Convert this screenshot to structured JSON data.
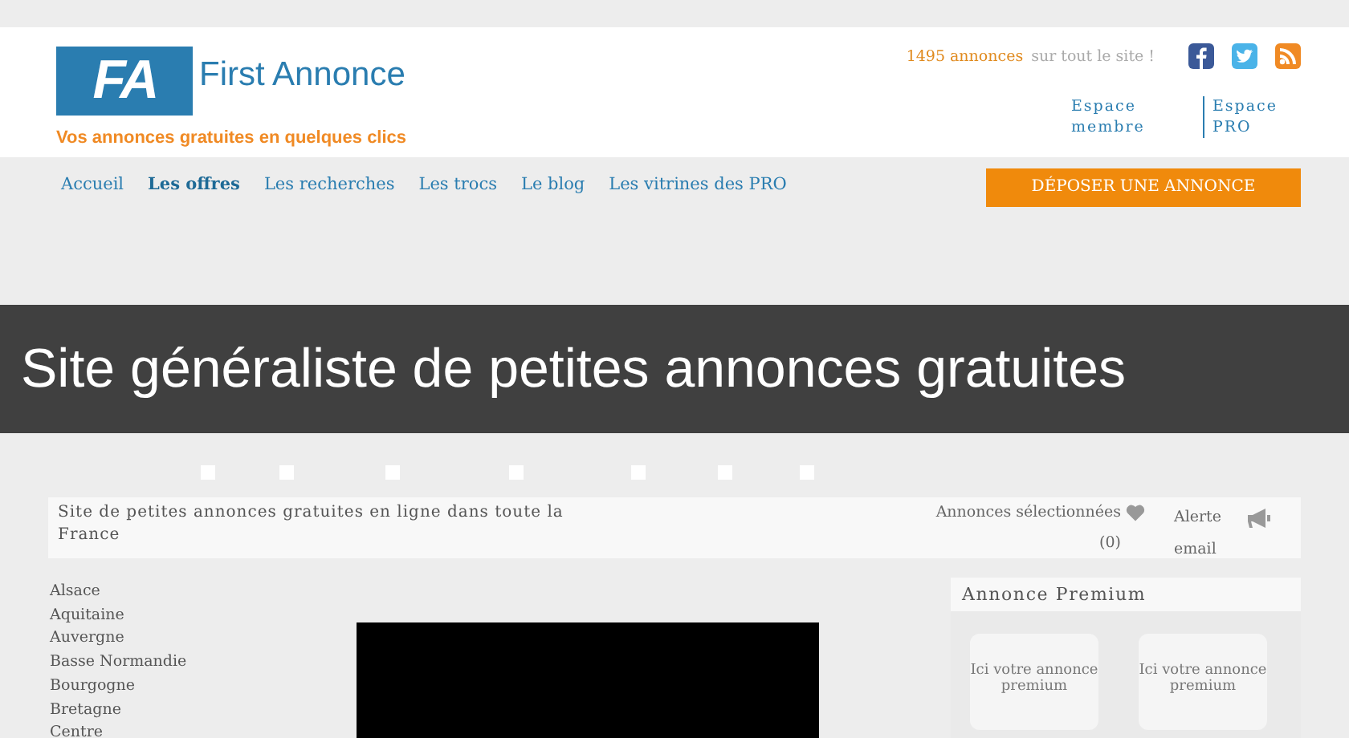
{
  "header": {
    "logo_mark": "FA",
    "logo_name": "First Annonce",
    "tagline": "Vos annonces gratuites en quelques clics",
    "count": "1495 annonces",
    "count_suffix": "sur tout le site !",
    "account_links": [
      "Espace membre",
      "Espace PRO"
    ]
  },
  "nav": {
    "items": [
      {
        "label": "Accueil",
        "selected": false
      },
      {
        "label": "Les offres",
        "selected": true
      },
      {
        "label": "Les recherches",
        "selected": false
      },
      {
        "label": "Les trocs",
        "selected": false
      },
      {
        "label": "Le blog",
        "selected": false
      },
      {
        "label": "Les vitrines des PRO",
        "selected": false
      }
    ],
    "cta": "DÉPOSER UNE ANNONCE"
  },
  "banner": {
    "title": "Site généraliste de petites annonces gratuites"
  },
  "checkboxes": [
    {
      "checked": false
    },
    {
      "checked": false
    },
    {
      "checked": false
    },
    {
      "checked": false
    },
    {
      "checked": false
    },
    {
      "checked": false
    },
    {
      "checked": false
    }
  ],
  "info_bar": {
    "description": "Site de petites annonces gratuites en ligne dans toute la France",
    "selected_label": "Annonces sélectionnées",
    "selected_count": "(0)",
    "alert": "Alerte email"
  },
  "regions": [
    "Alsace",
    "Aquitaine",
    "Auvergne",
    "Basse Normandie",
    "Bourgogne",
    "Bretagne",
    "Centre"
  ],
  "premium": {
    "title": "Annonce Premium",
    "slots": [
      "Ici votre annonce premium",
      "Ici votre annonce premium"
    ]
  }
}
